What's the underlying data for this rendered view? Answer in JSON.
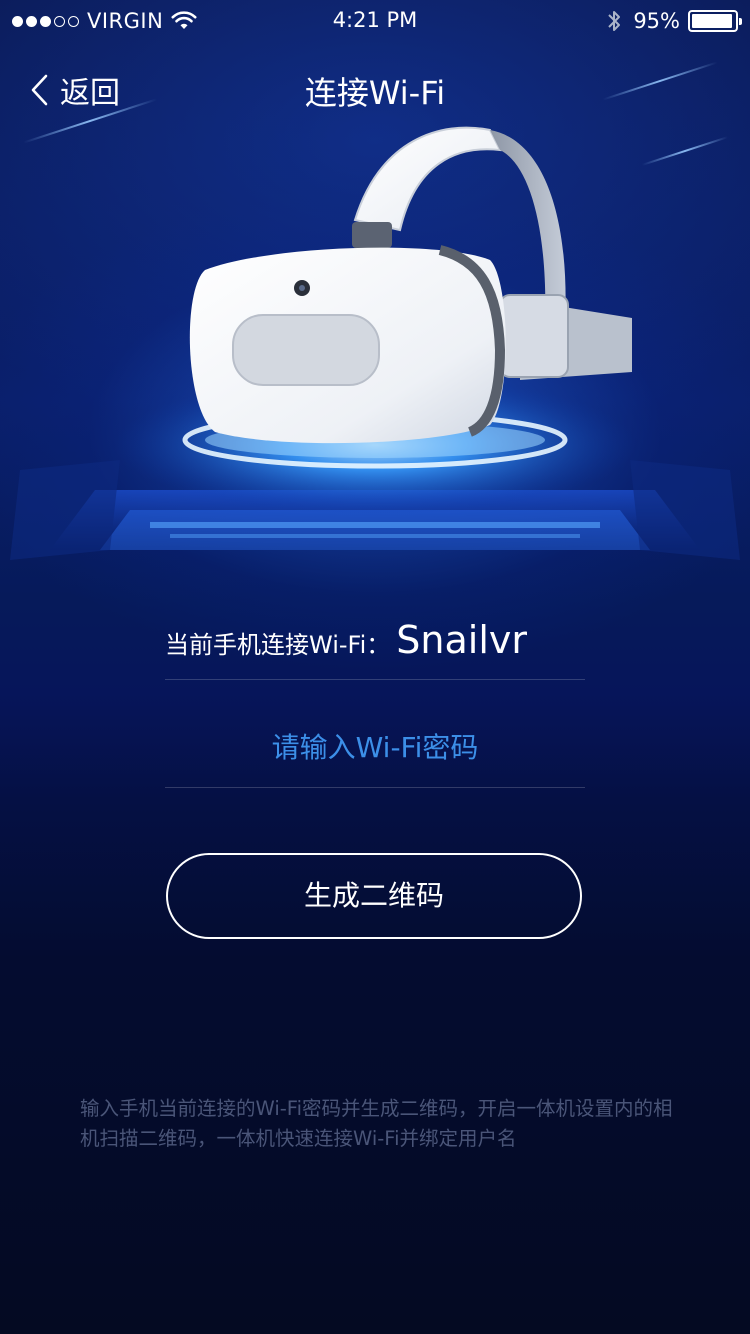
{
  "status_bar": {
    "signal_bars": [
      true,
      true,
      true,
      false,
      false
    ],
    "carrier": "VIRGIN",
    "time": "4:21 PM",
    "battery_text": "95%",
    "battery_level": 0.95,
    "icons": [
      "signal-dots-icon",
      "wifi-icon",
      "bluetooth-icon",
      "battery-icon"
    ]
  },
  "nav": {
    "back_label": "返回",
    "title": "连接Wi-Fi",
    "back_icon": "chevron-left-icon"
  },
  "hero": {
    "image": "vr-headset-illustration"
  },
  "form": {
    "current_wifi_label": "当前手机连接Wi-Fi：",
    "current_wifi_value": "Snailvr",
    "password_placeholder": "请输入Wi-Fi密码",
    "password_value": "",
    "generate_button": "生成二维码"
  },
  "hint": "输入手机当前连接的Wi-Fi密码并生成二维码，开启一体机设置内的相机扫描二维码，一体机快速连接Wi-Fi并绑定用户名",
  "colors": {
    "accent_blue": "#3c8fe8",
    "background_top": "#0b1a55",
    "background_bottom": "#040a22",
    "hint_text": "#4a5578"
  }
}
